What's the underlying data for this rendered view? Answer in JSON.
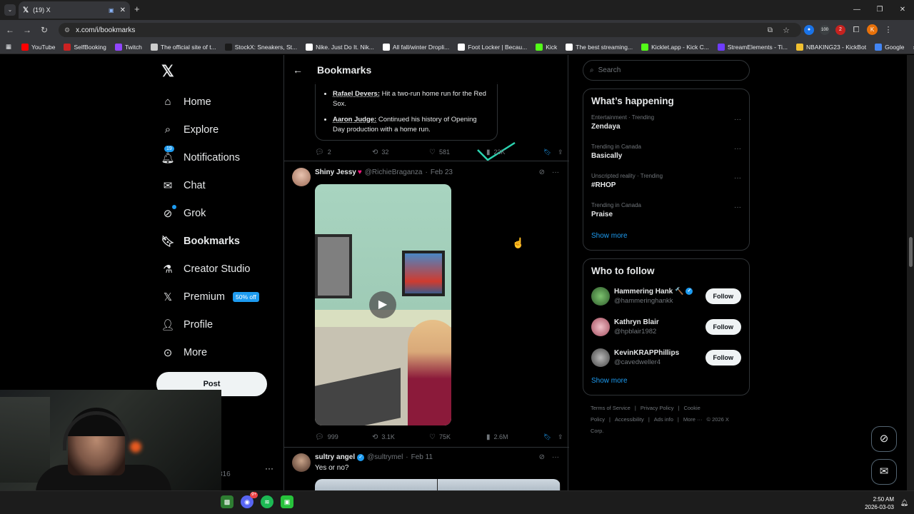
{
  "browser": {
    "tab_title": "(19) X",
    "url": "x.com/i/bookmarks",
    "bookmarks": [
      "YouTube",
      "SelfBooking",
      "Twitch",
      "The official site of t...",
      "StockX: Sneakers, St...",
      "Nike. Just Do It. Nik...",
      "All fall/winter Dropli...",
      "Foot Locker | Becau...",
      "Kick",
      "The best streaming...",
      "Kicklet.app - Kick C...",
      "StreamElements - Ti...",
      "NBAKING23 - KickBot",
      "Google"
    ],
    "ext_badge_1": "100",
    "ext_badge_2": "2",
    "profile_initial": "K"
  },
  "sidebar": {
    "items": [
      {
        "label": "Home",
        "icon": "home-icon"
      },
      {
        "label": "Explore",
        "icon": "search-icon"
      },
      {
        "label": "Notifications",
        "icon": "bell-icon"
      },
      {
        "label": "Chat",
        "icon": "mail-icon"
      },
      {
        "label": "Grok",
        "icon": "grok-icon"
      },
      {
        "label": "Bookmarks",
        "icon": "bookmark-icon"
      },
      {
        "label": "Creator Studio",
        "icon": "flask-icon"
      },
      {
        "label": "Premium",
        "icon": "x-icon"
      },
      {
        "label": "Profile",
        "icon": "person-icon"
      },
      {
        "label": "More",
        "icon": "more-circle-icon"
      }
    ],
    "notif_badge": "19",
    "premium_badge": "50% off",
    "post_label": "Post",
    "account_suffix": "316"
  },
  "main": {
    "title": "Bookmarks",
    "quote_items": [
      {
        "name": "Rafael Devers:",
        "text": " Hit a two-run home run for the Red Sox."
      },
      {
        "name": "Aaron Judge:",
        "text": " Continued his history of Opening Day production with a home run."
      }
    ],
    "tweet1_stats": {
      "replies": "2",
      "reposts": "32",
      "likes": "581",
      "views": "23K"
    },
    "tweet2": {
      "name": "Shiny Jessy",
      "handle": "@RichieBraganza",
      "date": "Feb 23",
      "stats": {
        "replies": "999",
        "reposts": "3.1K",
        "likes": "75K",
        "views": "2.6M"
      }
    },
    "tweet3": {
      "name": "sultry angel",
      "handle": "@sultrymel",
      "date": "Feb 11",
      "text": "Yes or no?"
    }
  },
  "right": {
    "search_placeholder": "Search",
    "happening_title": "What’s happening",
    "trends": [
      {
        "meta": "Entertainment · Trending",
        "name": "Zendaya"
      },
      {
        "meta": "Trending in Canada",
        "name": "Basically"
      },
      {
        "meta": "Unscripted reality · Trending",
        "name": "#RHOP"
      },
      {
        "meta": "Trending in Canada",
        "name": "Praise"
      }
    ],
    "show_more": "Show more",
    "follow_title": "Who to follow",
    "follow": [
      {
        "name": "Hammering Hank 🔨",
        "handle": "@hammeringhankk",
        "verified": true
      },
      {
        "name": "Kathryn Blair",
        "handle": "@hpblair1982",
        "verified": false
      },
      {
        "name": "KevinKRAPPhillips",
        "handle": "@cavedweller4",
        "verified": false
      }
    ],
    "follow_label": "Follow",
    "footer": [
      "Terms of Service",
      "|",
      "Privacy Policy",
      "|",
      "Cookie Policy",
      "|",
      "Accessibility",
      "|",
      "Ads info",
      "|",
      "More ···",
      "© 2026 X Corp."
    ]
  },
  "taskbar": {
    "time": "2:50 AM",
    "date": "2026-03-03",
    "discord_badge": "9+"
  },
  "colors": {
    "accent": "#1d9bf0",
    "like": "#f91880",
    "bg": "#000000",
    "border": "#2f3336"
  }
}
